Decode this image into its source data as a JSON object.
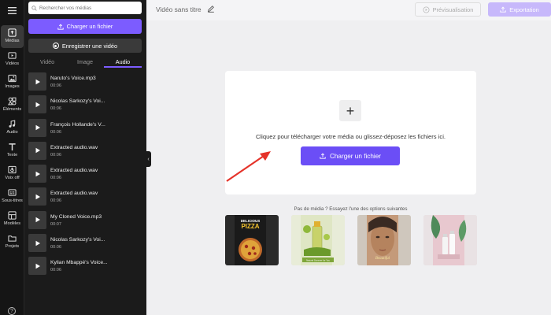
{
  "sidebar": {
    "menu_icon": "hamburger-icon",
    "items": [
      {
        "label": "Médias",
        "icon": "media-upload-icon",
        "active": true
      },
      {
        "label": "Vidéos",
        "icon": "video-icon"
      },
      {
        "label": "Images",
        "icon": "image-icon"
      },
      {
        "label": "Éléments",
        "icon": "shapes-icon"
      },
      {
        "label": "Audio",
        "icon": "music-note-icon"
      },
      {
        "label": "Texte",
        "icon": "text-icon"
      },
      {
        "label": "Voix off",
        "icon": "voiceover-icon"
      },
      {
        "label": "Sous-titres",
        "icon": "subtitles-icon"
      },
      {
        "label": "Modèles",
        "icon": "templates-icon"
      },
      {
        "label": "Projets",
        "icon": "folder-icon"
      }
    ],
    "help_icon": "help-icon"
  },
  "panel": {
    "search_placeholder": "Rechercher vos médias",
    "upload_label": "Charger un fichier",
    "record_label": "Enregistrer une vidéo",
    "tabs": [
      {
        "label": "Vidéo"
      },
      {
        "label": "Image"
      },
      {
        "label": "Audio",
        "active": true
      }
    ],
    "audio_items": [
      {
        "name": "Naruto's Voice.mp3",
        "duration": "00:06"
      },
      {
        "name": "Nicolas Sarkozy's Voi...",
        "duration": "00:06"
      },
      {
        "name": "François Hollande's V...",
        "duration": "00:06"
      },
      {
        "name": "Extracted audio.wav",
        "duration": "00:06"
      },
      {
        "name": "Extracted audio.wav",
        "duration": "00:06"
      },
      {
        "name": "Extracted audio.wav",
        "duration": "00:06"
      },
      {
        "name": "My Cloned Voice.mp3",
        "duration": "00:07"
      },
      {
        "name": "Nicolas Sarkozy's Voi...",
        "duration": "00:06"
      },
      {
        "name": "Kylian Mbappé's Voice...",
        "duration": "00:06"
      }
    ]
  },
  "header": {
    "title": "Vidéo sans titre",
    "preview_label": "Prévisualisation",
    "export_label": "Exportation"
  },
  "upload_area": {
    "hint": "Cliquez pour télécharger votre média ou glissez-déposez les fichiers ici.",
    "button_label": "Charger un fichier"
  },
  "suggestions": {
    "heading": "Pas de média ? Essayez l'une des options suivantes",
    "templates": [
      {
        "name": "pizza-template",
        "text_lines": [
          "DELICIOUS",
          "PIZZA"
        ]
      },
      {
        "name": "drink-template",
        "text_lines": [
          "Natural Summer for You"
        ]
      },
      {
        "name": "beauty-template",
        "text_lines": [
          "Beautiful"
        ]
      },
      {
        "name": "skincare-template",
        "text_lines": []
      }
    ]
  },
  "colors": {
    "accent": "#7c5cff",
    "accent_button": "#6b4ef6",
    "export_disabled": "#c7b8fb",
    "panel_bg": "#1b1b1b",
    "rail_bg": "#151515",
    "canvas_bg": "#efeff1",
    "arrow": "#e5332a"
  }
}
